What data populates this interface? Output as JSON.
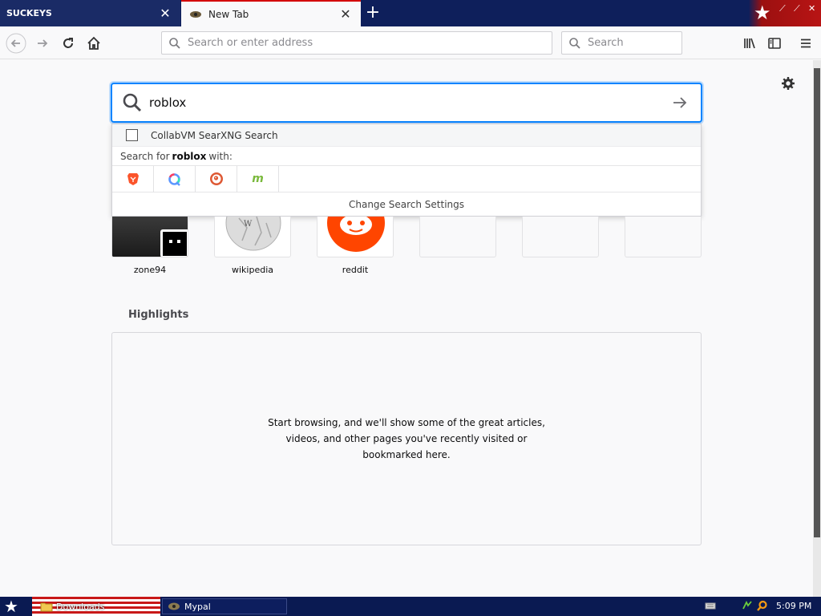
{
  "tabs": [
    {
      "title": "SUCKEYS",
      "active": false
    },
    {
      "title": "New Tab",
      "active": true
    }
  ],
  "nav": {
    "url_placeholder": "Search or enter address",
    "search_placeholder": "Search"
  },
  "search": {
    "value": "roblox"
  },
  "dropdown": {
    "suggestion": "CollabVM SearXNG Search",
    "search_for_prefix": "Search for",
    "search_for_query": "roblox",
    "search_for_suffix": "with:",
    "engines": [
      "brave-icon",
      "qwant-icon",
      "duckduckgo-icon",
      "mojeek-icon"
    ],
    "settings_label": "Change Search Settings"
  },
  "top_sites": [
    {
      "label": "zone94"
    },
    {
      "label": "wikipedia"
    },
    {
      "label": "reddit"
    },
    {
      "label": ""
    },
    {
      "label": ""
    },
    {
      "label": ""
    }
  ],
  "highlights": {
    "title": "Highlights",
    "message": "Start browsing, and we'll show some of the great articles, videos, and other pages you've recently visited or bookmarked here."
  },
  "taskbar": {
    "items": [
      "Downloads",
      "Mypal"
    ],
    "clock": "5:09 PM"
  },
  "colors": {
    "accent": "#0a84ff",
    "titlebar": "#0e1f5b",
    "reddit": "#ff4500"
  }
}
